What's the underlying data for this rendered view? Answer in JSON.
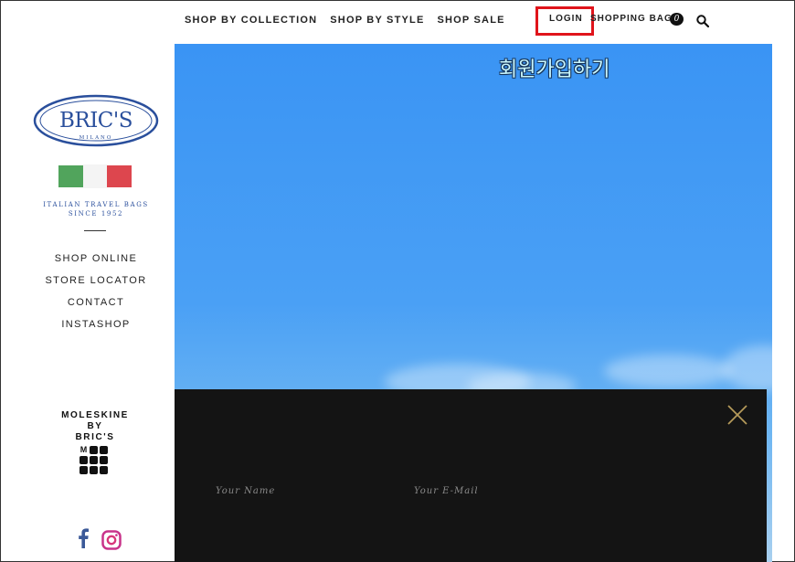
{
  "top_nav": {
    "items": [
      {
        "label": "SHOP BY COLLECTION"
      },
      {
        "label": "SHOP BY STYLE"
      },
      {
        "label": "SHOP SALE"
      }
    ],
    "login_label": "LOGIN",
    "bag_label": "SHOPPING BAG",
    "bag_count": "0",
    "search_icon": "search-icon"
  },
  "annotation": {
    "text": "회원가입하기",
    "highlight_color": "#e0141b"
  },
  "sidebar": {
    "logo_text": "BRIC'S",
    "logo_sub": "MILANO",
    "tagline_line1": "ITALIAN TRAVEL BAGS",
    "tagline_line2": "SINCE 1952",
    "nav": [
      {
        "label": "SHOP ONLINE"
      },
      {
        "label": "STORE LOCATOR"
      },
      {
        "label": "CONTACT"
      },
      {
        "label": "INSTASHOP"
      }
    ],
    "moleskine_line1": "MOLESKINE",
    "moleskine_line2": "BY",
    "moleskine_line3": "BRIC'S",
    "moleskine_mark": "M",
    "social_icons": [
      "facebook-icon",
      "instagram-icon"
    ]
  },
  "modal": {
    "name_placeholder": "Your Name",
    "email_placeholder": "Your E-Mail",
    "close_icon": "close-icon"
  },
  "colors": {
    "brand_blue": "#2a4f9c",
    "hero_sky": "#3a94f4",
    "modal_bg": "#141414",
    "close_gold": "#b59a5a"
  }
}
